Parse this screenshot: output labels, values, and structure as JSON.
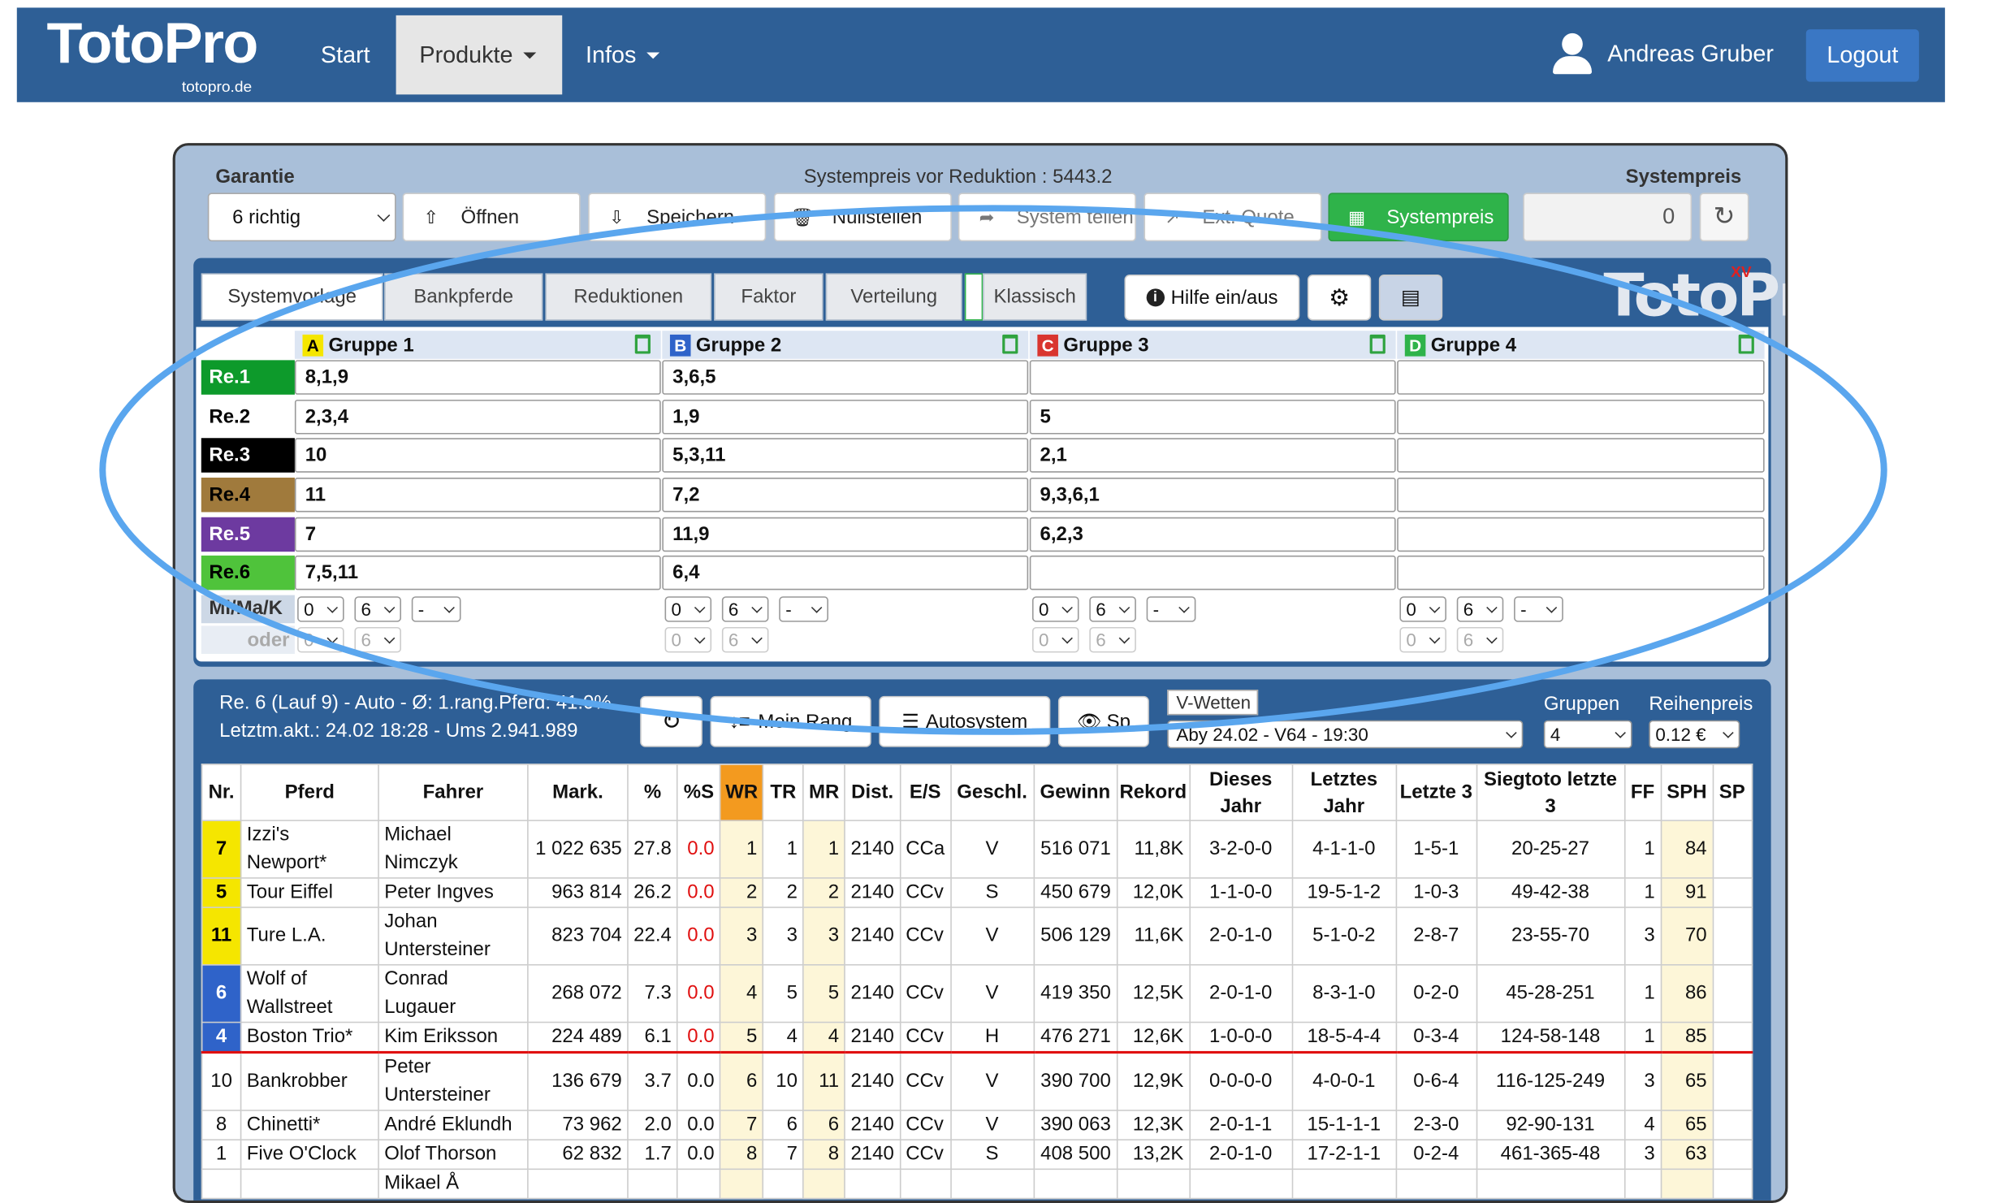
{
  "nav": {
    "logo": "TotoPro",
    "logo_sub": "totopro.de",
    "items": [
      {
        "label": "Start"
      },
      {
        "label": "Produkte"
      },
      {
        "label": "Infos"
      }
    ],
    "user": "Andreas Gruber",
    "logout": "Logout"
  },
  "top": {
    "garantie_label": "Garantie",
    "garantie_value": "6 richtig",
    "systempreis_vor": "Systempreis vor Reduktion : 5443.2",
    "systempreis_label": "Systempreis",
    "systempreis_value": "0",
    "buttons": [
      {
        "label": "Öffnen"
      },
      {
        "label": "Speichern"
      },
      {
        "label": "Nullstellen"
      },
      {
        "label": "System teilen"
      },
      {
        "label": "Ext. Quote"
      },
      {
        "label": "Systempreis"
      }
    ]
  },
  "tabs": [
    "Systemvorlage",
    "Bankpferde",
    "Reduktionen",
    "Faktor",
    "Verteilung",
    "Klassisch"
  ],
  "tools": {
    "help": "Hilfe ein/aus"
  },
  "watermark": "TotoPro",
  "watermark_sup": "XV",
  "groups": [
    {
      "letter": "A",
      "name": "Gruppe 1",
      "color": "#f5e600"
    },
    {
      "letter": "B",
      "name": "Gruppe 2",
      "color": "#2f63c9"
    },
    {
      "letter": "C",
      "name": "Gruppe 3",
      "color": "#d9352f"
    },
    {
      "letter": "D",
      "name": "Gruppe 4",
      "color": "#2fb34a"
    }
  ],
  "races": [
    {
      "label": "Re.1",
      "bg": "#0d9a2b",
      "fg": "#ffffff",
      "cells": [
        "8,1,9",
        "3,6,5",
        "",
        ""
      ]
    },
    {
      "label": "Re.2",
      "bg": "#ffffff",
      "fg": "#000000",
      "cells": [
        "2,3,4",
        "1,9",
        "5",
        ""
      ]
    },
    {
      "label": "Re.3",
      "bg": "#000000",
      "fg": "#ffffff",
      "cells": [
        "10",
        "5,3,11",
        "2,1",
        ""
      ]
    },
    {
      "label": "Re.4",
      "bg": "#a07a3c",
      "fg": "#000000",
      "cells": [
        "11",
        "7,2",
        "9,3,6,1",
        ""
      ]
    },
    {
      "label": "Re.5",
      "bg": "#6d3aa0",
      "fg": "#ffffff",
      "cells": [
        "7",
        "11,9",
        "6,2,3",
        ""
      ]
    },
    {
      "label": "Re.6",
      "bg": "#4fc33b",
      "fg": "#000000",
      "cells": [
        "7,5,11",
        "6,4",
        "",
        ""
      ]
    }
  ],
  "minmax": {
    "label": "Mi/Ma/K",
    "oder": "oder",
    "row1": [
      "0",
      "6",
      "-"
    ],
    "row2": [
      "0",
      "6"
    ]
  },
  "lower": {
    "info1": "Re. 6 (Lauf 9) - Auto - Ø: 1.rang.Pferd: 41.0%",
    "info2": "Letztm.akt.: 24.02 18:28 - Ums 2.941.989",
    "buttons": [
      "Mein Rang",
      "Autosystem",
      "Sp"
    ],
    "vwetten_label": "V-Wetten",
    "vwetten_value": "Åby 24.02 - V64 - 19:30",
    "gruppen_label": "Gruppen",
    "gruppen_value": "4",
    "reihenpreis_label": "Reihenpreis",
    "reihenpreis_value": "0.12 €"
  },
  "table": {
    "headers": [
      "Nr.",
      "Pferd",
      "Fahrer",
      "Mark.",
      "%",
      "%S",
      "WR",
      "TR",
      "MR",
      "Dist.",
      "E/S",
      "Geschl.",
      "Gewinn",
      "Rekord",
      "Dieses Jahr",
      "Letztes Jahr",
      "Letzte 3",
      "Siegtoto letzte 3",
      "FF",
      "SPH",
      "SP"
    ],
    "rows": [
      {
        "nr": "7",
        "nrbg": "#f5e600",
        "pferd": "Izzi's Newport*",
        "fahrer": "Michael Nimczyk",
        "mark": "1 022 635",
        "pct": "27.8",
        "ps": "0.0",
        "wr": "1",
        "tr": "1",
        "mr": "1",
        "dist": "2140",
        "es": "CCa",
        "geschl": "V",
        "gewinn": "516 071",
        "rekord": "11,8K",
        "dj": "3-2-0-0",
        "lj": "4-1-1-0",
        "l3": "1-5-1",
        "st": "20-25-27",
        "ff": "1",
        "sph": "84",
        "sp": ""
      },
      {
        "nr": "5",
        "nrbg": "#f5e600",
        "pferd": "Tour Eiffel",
        "fahrer": "Peter Ingves",
        "mark": "963 814",
        "pct": "26.2",
        "ps": "0.0",
        "wr": "2",
        "tr": "2",
        "mr": "2",
        "dist": "2140",
        "es": "CCv",
        "geschl": "S",
        "gewinn": "450 679",
        "rekord": "12,0K",
        "dj": "1-1-0-0",
        "lj": "19-5-1-2",
        "l3": "1-0-3",
        "st": "49-42-38",
        "ff": "1",
        "sph": "91",
        "sp": ""
      },
      {
        "nr": "11",
        "nrbg": "#f5e600",
        "pferd": "Ture L.A.",
        "fahrer": "Johan Untersteiner",
        "mark": "823 704",
        "pct": "22.4",
        "ps": "0.0",
        "wr": "3",
        "tr": "3",
        "mr": "3",
        "dist": "2140",
        "es": "CCv",
        "geschl": "V",
        "gewinn": "506 129",
        "rekord": "11,6K",
        "dj": "2-0-1-0",
        "lj": "5-1-0-2",
        "l3": "2-8-7",
        "st": "23-55-70",
        "ff": "3",
        "sph": "70",
        "sp": ""
      },
      {
        "nr": "6",
        "nrbg": "#2f63c9",
        "pferd": "Wolf of Wallstreet",
        "fahrer": "Conrad Lugauer",
        "mark": "268 072",
        "pct": "7.3",
        "ps": "0.0",
        "wr": "4",
        "tr": "5",
        "mr": "5",
        "dist": "2140",
        "es": "CCv",
        "geschl": "V",
        "gewinn": "419 350",
        "rekord": "12,5K",
        "dj": "2-0-1-0",
        "lj": "8-3-1-0",
        "l3": "0-2-0",
        "st": "45-28-251",
        "ff": "1",
        "sph": "86",
        "sp": ""
      },
      {
        "nr": "4",
        "nrbg": "#2f63c9",
        "pferd": "Boston Trio*",
        "fahrer": "Kim Eriksson",
        "mark": "224 489",
        "pct": "6.1",
        "ps": "0.0",
        "wr": "5",
        "tr": "4",
        "mr": "4",
        "dist": "2140",
        "es": "CCv",
        "geschl": "H",
        "gewinn": "476 271",
        "rekord": "12,6K",
        "dj": "1-0-0-0",
        "lj": "18-5-4-4",
        "l3": "0-3-4",
        "st": "124-58-148",
        "ff": "1",
        "sph": "85",
        "sp": ""
      },
      {
        "nr": "10",
        "nrbg": "",
        "pferd": "Bankrobber",
        "fahrer": "Peter Untersteiner",
        "mark": "136 679",
        "pct": "3.7",
        "ps": "0.0",
        "wr": "6",
        "tr": "10",
        "mr": "11",
        "dist": "2140",
        "es": "CCv",
        "geschl": "V",
        "gewinn": "390 700",
        "rekord": "12,9K",
        "dj": "0-0-0-0",
        "lj": "4-0-0-1",
        "l3": "0-6-4",
        "st": "116-125-249",
        "ff": "3",
        "sph": "65",
        "sp": ""
      },
      {
        "nr": "8",
        "nrbg": "",
        "pferd": "Chinetti*",
        "fahrer": "André Eklundh",
        "mark": "73 962",
        "pct": "2.0",
        "ps": "0.0",
        "wr": "7",
        "tr": "6",
        "mr": "6",
        "dist": "2140",
        "es": "CCv",
        "geschl": "V",
        "gewinn": "390 063",
        "rekord": "12,3K",
        "dj": "2-0-1-1",
        "lj": "15-1-1-1",
        "l3": "2-3-0",
        "st": "92-90-131",
        "ff": "4",
        "sph": "65",
        "sp": ""
      },
      {
        "nr": "1",
        "nrbg": "",
        "pferd": "Five O'Clock",
        "fahrer": "Olof Thorson",
        "mark": "62 832",
        "pct": "1.7",
        "ps": "0.0",
        "wr": "8",
        "tr": "7",
        "mr": "8",
        "dist": "2140",
        "es": "CCv",
        "geschl": "S",
        "gewinn": "408 500",
        "rekord": "13,2K",
        "dj": "2-0-1-0",
        "lj": "17-2-1-1",
        "l3": "0-2-4",
        "st": "461-365-48",
        "ff": "3",
        "sph": "63",
        "sp": ""
      },
      {
        "nr": "",
        "nrbg": "",
        "pferd": "",
        "fahrer": "Mikael Å",
        "mark": "",
        "pct": "",
        "ps": "",
        "wr": "",
        "tr": "",
        "mr": "",
        "dist": "",
        "es": "",
        "geschl": "",
        "gewinn": "",
        "rekord": "",
        "dj": "",
        "lj": "",
        "l3": "",
        "st": "",
        "ff": "",
        "sph": "",
        "sp": ""
      }
    ]
  },
  "colors": {
    "nav": "#2e5f96",
    "panel": "#a9bfd9",
    "accent_green": "#2fb34a",
    "wr_header": "#f39a1f",
    "overlay": "#5aa6ee"
  }
}
